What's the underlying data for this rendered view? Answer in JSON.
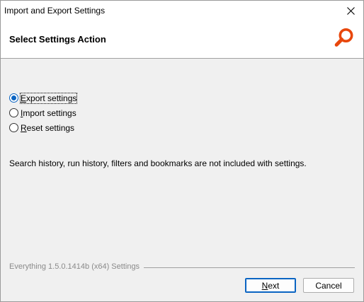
{
  "window": {
    "title": "Import and Export Settings"
  },
  "header": {
    "title": "Select Settings Action",
    "icon": "everything-search-icon",
    "accent_color": "#e8470c"
  },
  "options": [
    {
      "label_mnemonic": "E",
      "label_rest": "xport settings",
      "checked": true
    },
    {
      "label_mnemonic": "I",
      "label_rest": "mport settings",
      "checked": false
    },
    {
      "label_mnemonic": "R",
      "label_rest": "eset settings",
      "checked": false
    }
  ],
  "note": "Search history, run history, filters and bookmarks are not included with settings.",
  "footer": {
    "label": "Everything 1.5.0.1414b (x64) Settings"
  },
  "buttons": {
    "next_mnemonic": "N",
    "next_rest": "ext",
    "cancel": "Cancel"
  }
}
